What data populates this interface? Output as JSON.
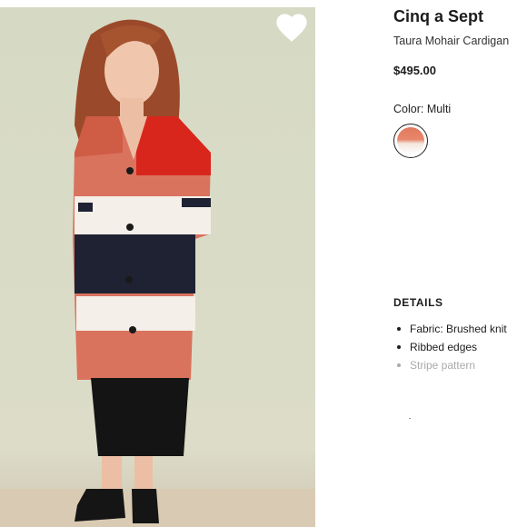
{
  "product": {
    "brand": "Cinq a Sept",
    "name": "Taura Mohair Cardigan",
    "price": "$495.00",
    "color_label": "Color: Multi",
    "favorite_icon": "heart-icon",
    "swatch_colors": [
      "#e07a5e",
      "#ffffff"
    ]
  },
  "details": {
    "heading": "DETAILS",
    "items": [
      "Fabric: Brushed knit",
      "Ribbed edges",
      "Stripe pattern"
    ]
  },
  "colors": {
    "photo_background": "#d8dcc8",
    "text": "#1c1c1c",
    "muted": "#aaaaaa"
  }
}
